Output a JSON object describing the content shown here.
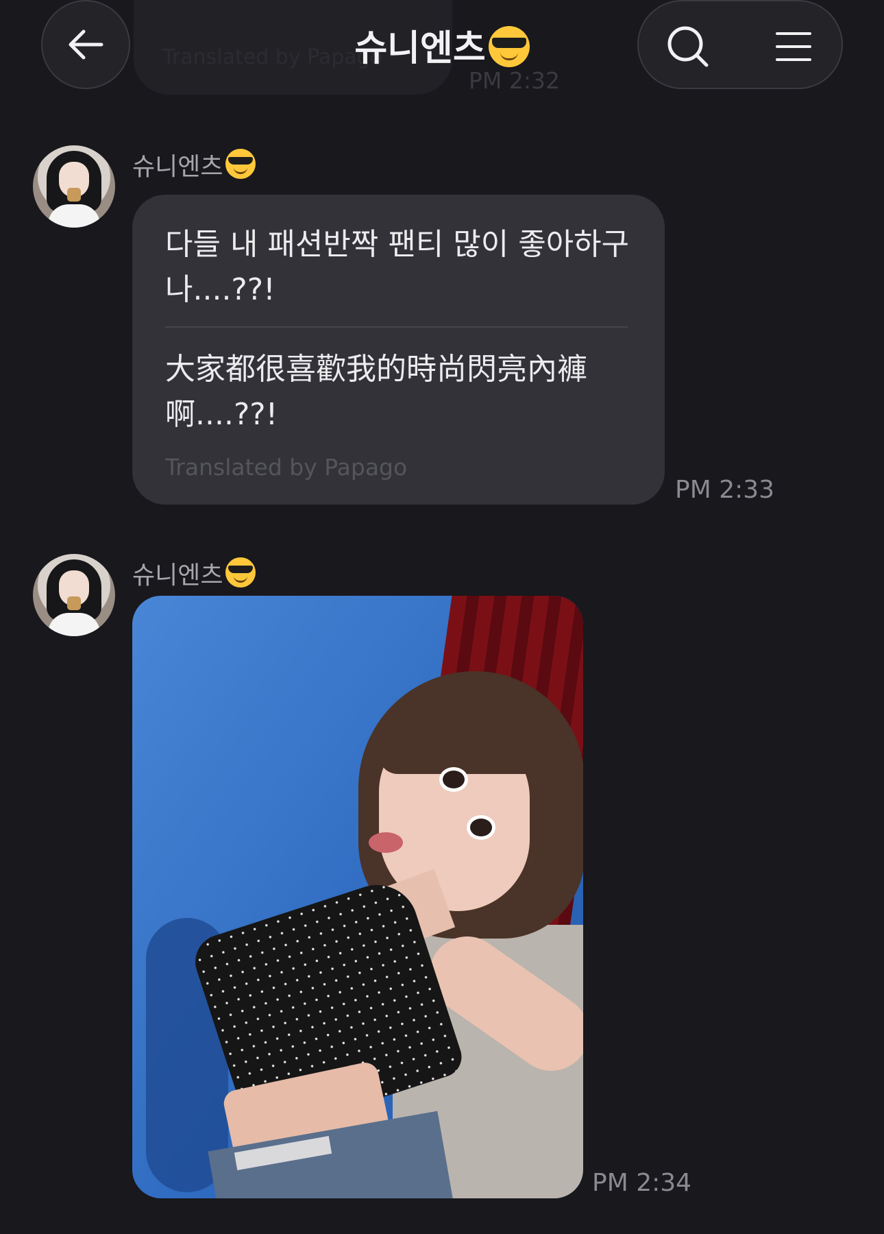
{
  "previous": {
    "text": "Translated by Papago",
    "time": "PM 2:32"
  },
  "header": {
    "title": "슈니엔츠",
    "back_icon": "arrow-left-icon",
    "search_icon": "search-icon",
    "menu_icon": "menu-icon"
  },
  "messages": [
    {
      "sender": "슈니엔츠",
      "text_ko": "다들 내 패션반짝 팬티 많이 좋아하구나....??!",
      "text_zh": "大家都很喜歡我的時尚閃亮內褲啊....??!",
      "translated_by": "Translated by Papago",
      "time": "PM 2:33"
    },
    {
      "sender": "슈니엔츠",
      "type": "photo",
      "time": "PM 2:34"
    }
  ],
  "colors": {
    "background": "#18181d",
    "bubble": "#323238"
  }
}
